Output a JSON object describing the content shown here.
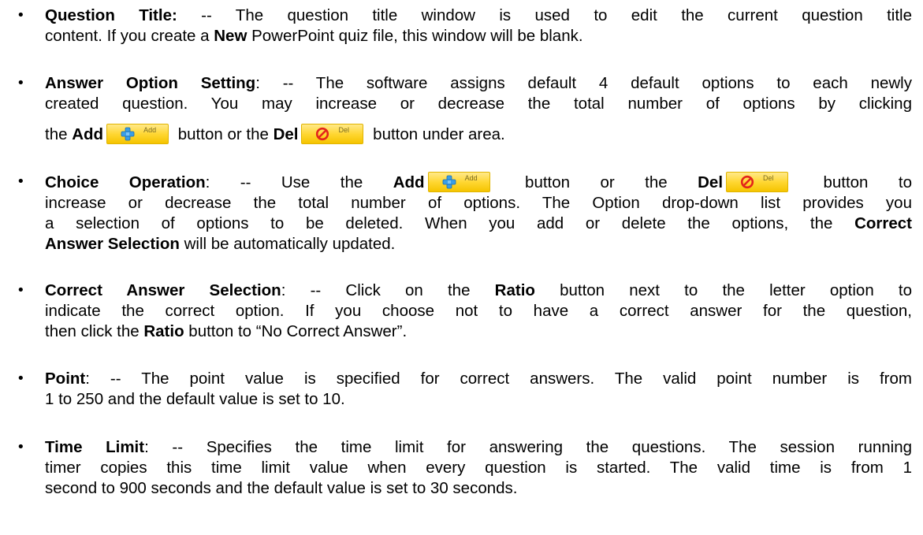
{
  "items": [
    {
      "title": "Question Title:",
      "text1": " -- The question title window is used to edit the current question title",
      "text2a": "content. If you create a ",
      "bold2": "New",
      "text2b": " PowerPoint quiz file, this window will be blank."
    },
    {
      "title": "Answer Option Setting",
      "text1": ": -- The software assigns default 4 default options to each newly",
      "text2": "created question. You may increase or decrease the total number of options by clicking",
      "text3a": "the ",
      "add_bold": "Add",
      "text3b": " button or the ",
      "del_bold": "Del",
      "text3c": " button under area."
    },
    {
      "title": "Choice Operation",
      "text1a": ": -- Use the ",
      "add_bold": "Add",
      "text1b": " button or the ",
      "del_bold": "Del",
      "text1c": " button to",
      "text2": "increase or decrease the total number of options. The Option drop-down list provides you",
      "text3a": "a selection of options to be deleted. When you add or delete the options, the ",
      "bold3": "Correct",
      "bold4": "Answer Selection",
      "text4": " will be automatically updated."
    },
    {
      "title": "Correct Answer Selection",
      "text1a": ": -- Click on the ",
      "bold1": "Ratio",
      "text1b": " button next to the letter option to",
      "text2": "indicate the correct option. If you choose not to have a correct answer for the question,",
      "text3a": "then click the ",
      "bold3": "Ratio",
      "text3b": " button to “No Correct Answer”."
    },
    {
      "title": "Point",
      "text1": ": -- The point value is specified for correct answers. The valid point number is from",
      "text2": "1 to 250 and the default value is set to 10."
    },
    {
      "title": "Time Limit",
      "text1": ": -- Specifies the time limit for answering the questions. The session running",
      "text2": "timer copies this time limit value when every question is started. The valid time is from 1",
      "text3": "second to 900 seconds and the default value is set to 30 seconds."
    }
  ],
  "buttons": {
    "add_label": "Add",
    "del_label": "Del",
    "add_icon": "plus-icon",
    "del_icon": "no-entry-icon",
    "color": "#ffd733"
  },
  "bullet": "•"
}
